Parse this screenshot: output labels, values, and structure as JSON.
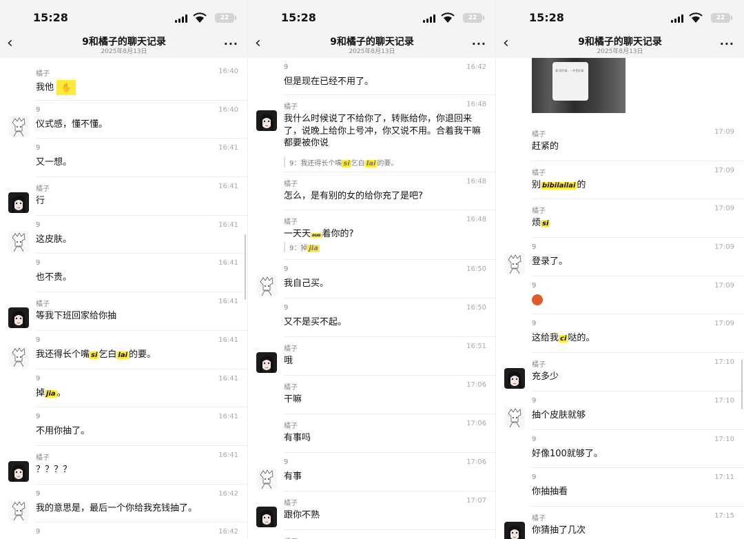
{
  "status": {
    "time": "15:28",
    "battery": "22"
  },
  "header": {
    "title": "9和橘子的聊天记录",
    "date": "2025年8月13日",
    "back": "‹",
    "more": "···"
  },
  "panels": [
    {
      "messages": [
        {
          "sender": "橘子",
          "time": "16:40",
          "text": "我他",
          "avatar": "girl"
        },
        {
          "sender": "9",
          "time": "16:40",
          "text": "仪式感，懂不懂。",
          "avatar": "boy"
        },
        {
          "sender": "9",
          "time": "16:41",
          "text": "又一想。",
          "avatar": ""
        },
        {
          "sender": "橘子",
          "time": "16:41",
          "text": "行",
          "avatar": "girl"
        },
        {
          "sender": "9",
          "time": "16:41",
          "text": "这皮肤。",
          "avatar": "boy"
        },
        {
          "sender": "9",
          "time": "16:41",
          "text": "也不贵。",
          "avatar": ""
        },
        {
          "sender": "橘子",
          "time": "16:41",
          "text": "等我下班回家给你抽",
          "avatar": "girl"
        },
        {
          "sender": "9",
          "time": "16:41",
          "text_a": "我还得长个嘴",
          "hl1": "si",
          "text_b": "乞白",
          "hl2": "lai",
          "text_c": "的要。",
          "avatar": "boy"
        },
        {
          "sender": "9",
          "time": "16:41",
          "text_a": "掉",
          "hl1": "jia",
          "text_b": "。",
          "avatar": ""
        },
        {
          "sender": "9",
          "time": "16:41",
          "text": "不用你抽了。",
          "avatar": ""
        },
        {
          "sender": "橘子",
          "time": "16:41",
          "text": "？？？？",
          "avatar": "girl"
        },
        {
          "sender": "9",
          "time": "16:42",
          "text": "我的意思是，最后一个你给我充钱抽了。",
          "avatar": "boy"
        },
        {
          "sender": "9",
          "time": "16:42",
          "text": "",
          "avatar": ""
        }
      ]
    },
    {
      "messages": [
        {
          "sender": "9",
          "time": "16:42",
          "text": "但是现在已经不用了。",
          "avatar": ""
        },
        {
          "sender": "橘子",
          "time": "16:48",
          "text": "我什么时候说了不给你了，转账给你，你退回来了，说晚上给你上号冲，你又说不用。合着我干嘛都要被你说",
          "quote_a": "9：我还得长个嘴",
          "quote_hl1": "si",
          "quote_b": "乞白",
          "quote_hl2": "lai",
          "quote_c": "的要。",
          "avatar": "girl"
        },
        {
          "sender": "橘子",
          "time": "16:48",
          "text": "怎么，是有别的女的给你充了是吧?",
          "avatar": ""
        },
        {
          "sender": "橘子",
          "time": "16:48",
          "text": "一天天",
          "text_hl": "ouo",
          "text_b": "着你的?",
          "quote_a": "9：掉",
          "quote_hl1": "jia",
          "avatar": ""
        },
        {
          "sender": "9",
          "time": "16:50",
          "text": "我自己买。",
          "avatar": "boy"
        },
        {
          "sender": "9",
          "time": "16:50",
          "text": "又不是买不起。",
          "avatar": ""
        },
        {
          "sender": "橘子",
          "time": "16:51",
          "text": "哦",
          "avatar": "girl"
        },
        {
          "sender": "橘子",
          "time": "17:06",
          "text": "干嘛",
          "avatar": ""
        },
        {
          "sender": "橘子",
          "time": "17:06",
          "text": "有事吗",
          "avatar": ""
        },
        {
          "sender": "9",
          "time": "17:06",
          "text": "有事",
          "avatar": "boy"
        },
        {
          "sender": "橘子",
          "time": "17:07",
          "text": "跟你不熟",
          "avatar": "girl"
        },
        {
          "sender": "橘子",
          "time": "",
          "text": "",
          "avatar": ""
        }
      ]
    },
    {
      "photo_text": "事 两件事，一件是好事",
      "messages": [
        {
          "sender": "橘子",
          "time": "17:09",
          "text": "赶紧的",
          "avatar": ""
        },
        {
          "sender": "橘子",
          "time": "17:09",
          "text_a": "别",
          "hl1": "bibilailai",
          "text_b": "的",
          "avatar": ""
        },
        {
          "sender": "橘子",
          "time": "17:09",
          "text_a": "烦",
          "hl1": "si",
          "text_b": "",
          "avatar": ""
        },
        {
          "sender": "9",
          "time": "17:09",
          "text": "登录了。",
          "avatar": "boy"
        },
        {
          "sender": "9",
          "time": "17:09",
          "text": "",
          "emoji": "face",
          "avatar": ""
        },
        {
          "sender": "9",
          "time": "17:09",
          "text_a": "这给我",
          "hl1": "ci",
          "text_b": "哒的。",
          "avatar": ""
        },
        {
          "sender": "橘子",
          "time": "17:10",
          "text": "充多少",
          "avatar": "girl"
        },
        {
          "sender": "9",
          "time": "17:10",
          "text": "抽个皮肤就够",
          "avatar": "boy"
        },
        {
          "sender": "9",
          "time": "17:10",
          "text": "好像100就够了。",
          "avatar": ""
        },
        {
          "sender": "9",
          "time": "17:11",
          "text": "你抽抽看",
          "avatar": ""
        },
        {
          "sender": "橘子",
          "time": "17:15",
          "text": "你猜抽了几次",
          "avatar": "girl"
        }
      ]
    }
  ]
}
